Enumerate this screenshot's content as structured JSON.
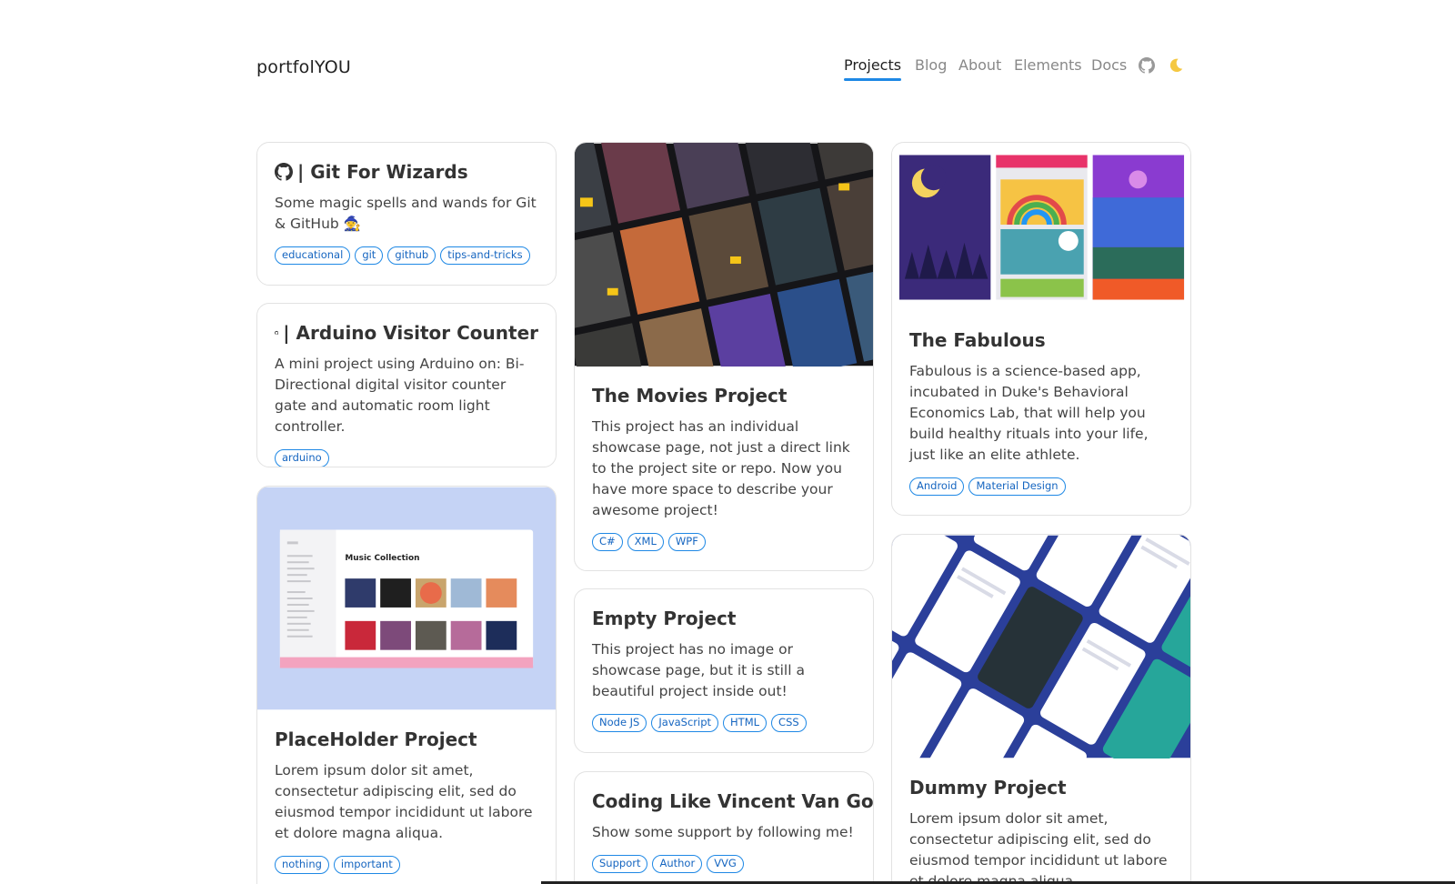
{
  "brand": "portfolYOU",
  "nav": {
    "items": [
      "Projects",
      "Blog",
      "About",
      "Elements",
      "Docs"
    ],
    "active": "Projects",
    "github_icon": "github-icon",
    "theme_icon": "moon-icon"
  },
  "colors": {
    "accent": "#1e88e5",
    "text": "#333333",
    "border": "#e2e2e2"
  },
  "projects": [
    {
      "title": "| Git For Wizards",
      "icon": "github-icon",
      "text": "Some magic spells and wands for Git & GitHub 🧙",
      "tags": [
        "educational",
        "git",
        "github",
        "tips-and-tricks"
      ]
    },
    {
      "title": "| Arduino Visitor Counter",
      "icon": "github-icon",
      "text": "A mini project using Arduino on: Bi-Directional digital visitor counter gate and automatic room light controller.",
      "tags": [
        "arduino"
      ]
    },
    {
      "title": "PlaceHolder Project",
      "image": "music-collection-screenshot",
      "image_text": "Music Collection",
      "text": "Lorem ipsum dolor sit amet, consectetur adipiscing elit, sed do eiusmod tempor incididunt ut labore et dolore magna aliqua.",
      "tags": [
        "nothing",
        "important"
      ]
    },
    {
      "title": "The Movies Project",
      "image": "movie-posters-collage",
      "text": "This project has an individual showcase page, not just a direct link to the project site or repo. Now you have more space to describe your awesome project!",
      "tags": [
        "C#",
        "XML",
        "WPF"
      ]
    },
    {
      "title": "Empty Project",
      "text": "This project has no image or showcase page, but it is still a beautiful project inside out!",
      "tags": [
        "Node JS",
        "JavaScript",
        "HTML",
        "CSS"
      ]
    },
    {
      "title": "Coding Like Vincent Van Gogh",
      "text": "Show some support by following me!",
      "tags": [
        "Support",
        "Author",
        "VVG"
      ]
    },
    {
      "title": "The Fabulous",
      "image": "fabulous-app-screens",
      "text": "Fabulous is a science-based app, incubated in Duke's Behavioral Economics Lab, that will help you build healthy rituals into your life, just like an elite athlete.",
      "tags": [
        "Android",
        "Material Design"
      ]
    },
    {
      "title": "Dummy Project",
      "image": "mobile-app-screens-collage",
      "text": "Lorem ipsum dolor sit amet, consectetur adipiscing elit, sed do eiusmod tempor incididunt ut labore et dolore magna aliqua.",
      "tags": []
    }
  ]
}
